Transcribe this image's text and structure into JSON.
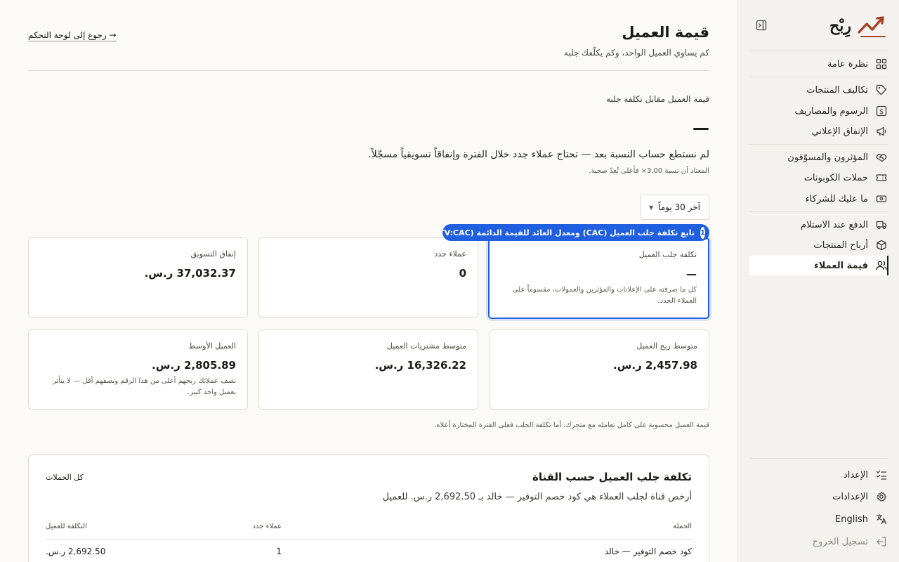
{
  "sidebar": {
    "brand": "رِبْح",
    "groups": [
      [
        {
          "label": "نظرة عامة",
          "icon": "grid-icon"
        }
      ],
      [
        {
          "label": "تكاليف المنتجات",
          "icon": "tag-icon"
        },
        {
          "label": "الرسوم والمصاريف",
          "icon": "dollar-icon"
        },
        {
          "label": "الإنفاق الإعلاني",
          "icon": "megaphone-icon"
        }
      ],
      [
        {
          "label": "المؤثرون والمسوّقون",
          "icon": "handshake-icon"
        },
        {
          "label": "حملات الكوبونات",
          "icon": "ticket-icon"
        },
        {
          "label": "ما عليك للشركاء",
          "icon": "banknote-icon"
        }
      ],
      [
        {
          "label": "الدفع عند الاستلام",
          "icon": "truck-icon"
        },
        {
          "label": "أرباح المنتجات",
          "icon": "box-icon"
        },
        {
          "label": "قيمة العملاء",
          "icon": "users-icon",
          "active": true
        }
      ]
    ],
    "bottom": [
      {
        "label": "الإعداد",
        "icon": "checklist-icon"
      },
      {
        "label": "الإعدادات",
        "icon": "gear-icon"
      },
      {
        "label": "English",
        "icon": "translate-icon"
      },
      {
        "label": "تسجيل الخروج",
        "icon": "logout-icon",
        "muted": true
      }
    ]
  },
  "header": {
    "title": "قيمة العميل",
    "subtitle": "كم يساوي العميل الواحد، وكم يكلّفك جلبه",
    "back_link": "→ رجوع إلى لوحة التحكم"
  },
  "ratio": {
    "label": "قيمة العميل مقابل تكلفة جلبه",
    "value": "—",
    "message": "لم نستطع حساب النسبة بعد — تحتاج عملاء جدد خلال الفترة وإنفاقاً تسويقياً مسجّلاً.",
    "note": "المعتاد أن نسبة 3.00× فأعلى تُعدّ صحية."
  },
  "period": {
    "selected": "آخر 30 يوماً"
  },
  "tour": {
    "step": "1",
    "text": "تابع تكلفة جلب العميل (CAC) ومعدل العائد للقيمة الدائمة (LTV:CAC)"
  },
  "cards": [
    {
      "label": "تكلفة جلب العميل",
      "value": "—",
      "desc": "كل ما صرفته على الإعلانات والمؤثرين والعمولات، مقسوماً على العملاء الجدد.",
      "highlight": true
    },
    {
      "label": "عملاء جدد",
      "value": "0",
      "desc": ""
    },
    {
      "label": "إنفاق التسويق",
      "value": "37,032.37 ر.س.",
      "desc": ""
    },
    {
      "label": "متوسط ربح العميل",
      "value": "2,457.98 ر.س.",
      "desc": ""
    },
    {
      "label": "متوسط مشتريات العميل",
      "value": "16,326.22 ر.س.",
      "desc": ""
    },
    {
      "label": "العميل الأوسط",
      "value": "2,805.89 ر.س.",
      "desc": "نصف عملائك ربحهم أعلى من هذا الرقم ونصفهم أقل — لا يتأثر بعميل واحد كبير."
    }
  ],
  "clv_note": "قيمة العميل محسوبة على كامل تعامله مع متجرك، أما تكلفة الجلب فعلى الفترة المختارة أعلاه.",
  "channel_table": {
    "title": "تكلفة جلب العميل حسب القناة",
    "subtitle": "أرخص قناة لجلب العملاء هي كود خصم التوفير — خالد بـ 2,692.50 ر.س. للعميل",
    "filter": "كل الحملات",
    "columns": [
      "الحملة",
      "عملاء جدد",
      "التكلفة للعميل"
    ],
    "rows": [
      {
        "campaign": "كود خصم التوفير — خالد",
        "new_customers": "1",
        "cost": "2,692.50 ر.س."
      }
    ]
  },
  "colors": {
    "accent": "#1f5fe0",
    "brand": "#a8432a"
  }
}
